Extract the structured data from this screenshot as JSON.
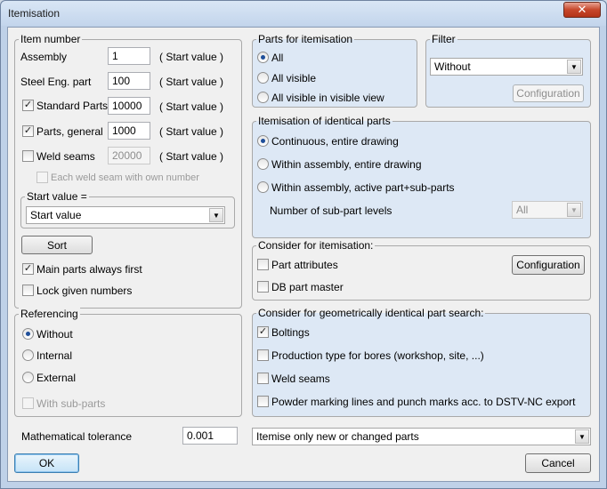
{
  "window": {
    "title": "Itemisation",
    "close_glyph": "✕"
  },
  "item_number": {
    "legend": "Item number",
    "rows": [
      {
        "label": "Assembly",
        "value": "1",
        "suffix": "( Start value )"
      },
      {
        "label": "Steel Eng. part",
        "value": "100",
        "suffix": "( Start value )"
      },
      {
        "label": "Standard Parts",
        "value": "10000",
        "suffix": "( Start value )"
      },
      {
        "label": "Parts, general",
        "value": "1000",
        "suffix": "( Start value )"
      },
      {
        "label": "Weld seams",
        "value": "20000",
        "suffix": "( Start value )"
      }
    ],
    "each_weld_label": "Each weld seam with own number",
    "start_value_legend": "Start value =",
    "start_value_selected": "Start value",
    "sort_label": "Sort",
    "main_parts_first_label": "Main parts always first",
    "lock_numbers_label": "Lock given numbers"
  },
  "referencing": {
    "legend": "Referencing",
    "options": [
      "Without",
      "Internal",
      "External"
    ],
    "with_subparts_label": "With sub-parts"
  },
  "tolerance": {
    "label": "Mathematical tolerance",
    "value": "0.001"
  },
  "parts_for_itemisation": {
    "legend": "Parts for itemisation",
    "options": [
      "All",
      "All visible",
      "All visible in visible view"
    ]
  },
  "filter": {
    "legend": "Filter",
    "selected": "Without",
    "config_label": "Configuration"
  },
  "identical_parts": {
    "legend": "Itemisation of identical parts",
    "options": [
      "Continuous, entire drawing",
      "Within assembly, entire drawing",
      "Within assembly,  active part+sub-parts"
    ],
    "levels_label": "Number of sub-part levels",
    "levels_selected": "All"
  },
  "consider": {
    "legend": "Consider for itemisation:",
    "part_attributes_label": "Part attributes",
    "db_part_master_label": "DB part master",
    "config_label": "Configuration"
  },
  "geometric": {
    "legend": "Consider for geometrically identical part search:",
    "boltings_label": "Boltings",
    "production_type_label": "Production type for bores (workshop, site, ...)",
    "weld_seams_label": "Weld seams",
    "powder_marking_label": "Powder marking lines and punch marks acc. to DSTV-NC export"
  },
  "itemise_mode": {
    "selected": "Itemise only new or changed parts"
  },
  "buttons": {
    "ok_label": "OK",
    "cancel_label": "Cancel"
  },
  "icons": {
    "check": "✓",
    "dropdown": "▼"
  }
}
